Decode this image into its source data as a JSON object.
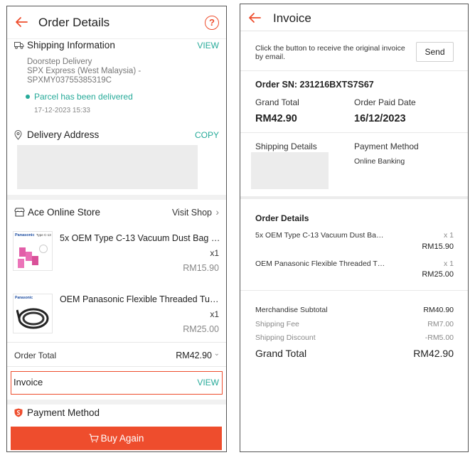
{
  "order_details": {
    "title": "Order Details",
    "help_symbol": "?",
    "shipping": {
      "title": "Shipping Information",
      "view": "VIEW",
      "method": "Doorstep Delivery",
      "courier": "SPX Express (West Malaysia) -",
      "tracking": "SPXMY03755385319C",
      "status": "Parcel has been delivered",
      "status_time": "17-12-2023 15:33"
    },
    "delivery": {
      "title": "Delivery Address",
      "copy": "COPY"
    },
    "store": {
      "name": "Ace Online Store",
      "visit": "Visit Shop"
    },
    "products": [
      {
        "name": "5x OEM Type C-13 Vacuum Dust Bag Us…",
        "qty": "x1",
        "price": "RM15.90",
        "thumb_brand": "Panasonic",
        "thumb_type": "Type C-13"
      },
      {
        "name": "OEM Panasonic Flexible Threaded Tube…",
        "qty": "x1",
        "price": "RM25.00",
        "thumb_brand": "Panasonic"
      }
    ],
    "order_total_label": "Order Total",
    "order_total_value": "RM42.90",
    "invoice_label": "Invoice",
    "invoice_view": "VIEW",
    "payment_method": "Payment Method",
    "buy_again": "Buy Again"
  },
  "invoice": {
    "title": "Invoice",
    "instruction_line1": "Click the button to receive the original invoice",
    "instruction_line2": "by email.",
    "send": "Send",
    "order_sn": "Order SN: 231216BXTS7S67",
    "grand_total_label": "Grand Total",
    "grand_total_value": "RM42.90",
    "paid_date_label": "Order Paid Date",
    "paid_date_value": "16/12/2023",
    "shipping_details_label": "Shipping Details",
    "payment_method_label": "Payment Method",
    "payment_method_value": "Online Banking",
    "order_details_title": "Order Details",
    "items": [
      {
        "name": "5x OEM Type C-13 Vacuum Dust Ba…",
        "qty": "x 1",
        "price": "RM15.90"
      },
      {
        "name": "OEM Panasonic Flexible Threaded T…",
        "qty": "x 1",
        "price": "RM25.00"
      }
    ],
    "merch_subtotal_label": "Merchandise Subtotal",
    "merch_subtotal_value": "RM40.90",
    "shipping_fee_label": "Shipping Fee",
    "shipping_fee_value": "RM7.00",
    "shipping_discount_label": "Shipping Discount",
    "shipping_discount_value": "-RM5.00",
    "grand_total_bottom_label": "Grand Total",
    "grand_total_bottom_value": "RM42.90"
  },
  "colors": {
    "accent": "#ee4d2d",
    "teal": "#26aa99"
  }
}
